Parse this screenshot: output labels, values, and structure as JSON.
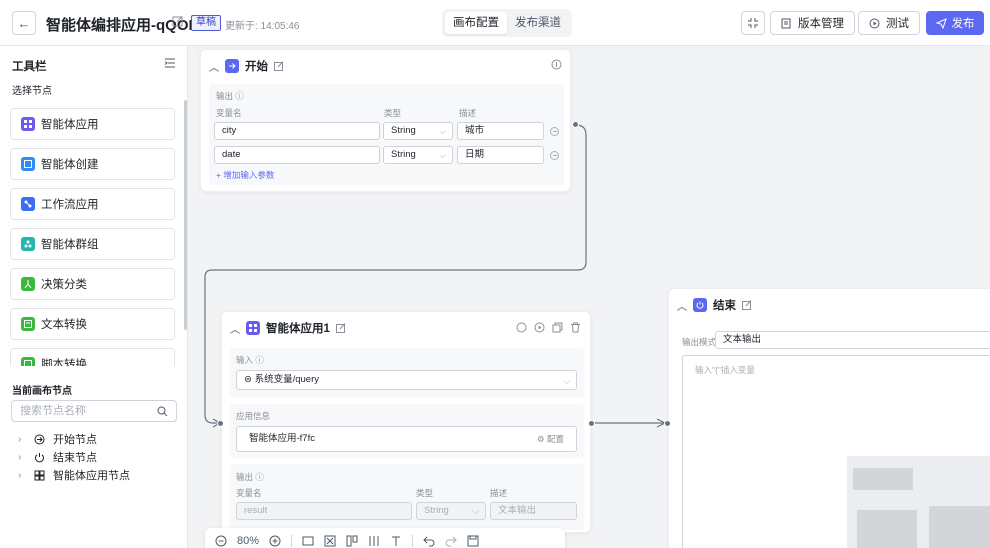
{
  "header": {
    "title": "智能体编排应用-qQOH",
    "badge": "草稿",
    "updated": "更新于: 14:05:46",
    "tabs": [
      "画布配置",
      "发布渠道"
    ],
    "version_label": "版本管理",
    "test_label": "测试",
    "publish_label": "发布"
  },
  "sidebar": {
    "title": "工具栏",
    "subtitle": "选择节点",
    "tools": [
      {
        "label": "智能体应用",
        "color": "#6b5cf0"
      },
      {
        "label": "智能体创建",
        "color": "#2f8cf0"
      },
      {
        "label": "工作流应用",
        "color": "#3b6df0"
      },
      {
        "label": "智能体群组",
        "color": "#22b8b0"
      },
      {
        "label": "决策分类",
        "color": "#3cb93c"
      },
      {
        "label": "文本转换",
        "color": "#3cb93c"
      },
      {
        "label": "脚本转换",
        "color": "#3cb93c"
      }
    ],
    "section2": "当前画布节点",
    "search_placeholder": "搜索节点名称",
    "tree": [
      "开始节点",
      "结束节点",
      "智能体应用节点"
    ]
  },
  "start_node": {
    "title": "开始",
    "output_label": "输出 ⓘ",
    "col_name": "变量名",
    "col_type": "类型",
    "col_desc": "描述",
    "rows": [
      {
        "name": "city",
        "type": "String",
        "desc": "城市"
      },
      {
        "name": "date",
        "type": "String",
        "desc": "日期"
      }
    ],
    "add_param": "+ 增加输入参数"
  },
  "agent_node": {
    "title": "智能体应用1",
    "input_label": "输入 ⓘ",
    "input_value": "⊜ 系统变量/query",
    "app_info_label": "应用信息",
    "app_name": "智能体应用-f7fc",
    "config_label": "⚙ 配置",
    "output_label": "输出 ⓘ",
    "col_name": "变量名",
    "col_type": "类型",
    "col_desc": "描述",
    "out_name": "result",
    "out_type": "String",
    "out_desc": "文本输出"
  },
  "end_node": {
    "title": "结束",
    "mode_label": "输出模式",
    "mode_value": "文本输出",
    "textarea_placeholder": "输入\"{\"插入变量"
  },
  "zoom": "80%"
}
